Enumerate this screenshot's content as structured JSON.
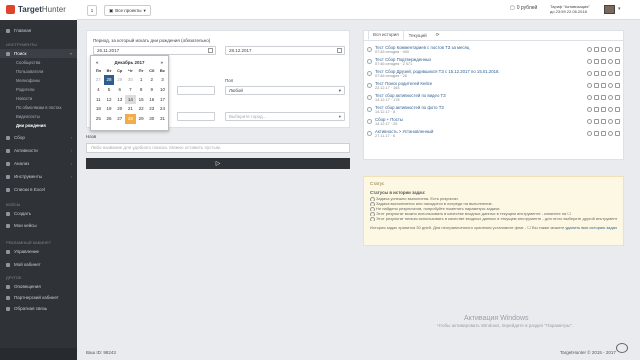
{
  "topbar": {
    "logo_target": "Target",
    "logo_hunter": "Hunter",
    "counter": "1",
    "projects_label": "Все проекты",
    "money": "0 рублей",
    "tariff_line1": "Тариф \"Активизация\"",
    "tariff_line2": "до 23:59 22.06.2018"
  },
  "sidebar": {
    "home": "Главная",
    "tools_section": "ИНСТРУМЕНТЫ",
    "search": "Поиск",
    "search_sub": [
      "Сообщества",
      "Пользователи",
      "Мелиофаны",
      "Родители",
      "Новости",
      "По обмолвкам в постах",
      "Видеопосты",
      "Дни рождения"
    ],
    "others": [
      "Сбор",
      "Активности",
      "Анализ",
      "Инструменты",
      "Списки в Excel"
    ],
    "cases_section": "КЕЙСЫ",
    "cases": [
      "Создать",
      "Мои кейсы"
    ],
    "cabinet_section": "РЕКЛАМНЫЙ КАБИНЕТ",
    "cabinet": [
      "Управление",
      "Мой кабинет"
    ],
    "other_section": "ДРУГОЕ",
    "other": [
      "Оповещения",
      "Партнерский кабинет",
      "Обратная связь"
    ]
  },
  "form": {
    "period_label": "Период, за который искать дни рождения (обязательно)",
    "date_from": "26.11.2017",
    "date_to": "28.12.2017",
    "gender_label": "Пол",
    "gender_value": "Любой",
    "city_placeholder": "Выберите город...",
    "desc_label": "Назв",
    "desc_placeholder": "Либо название для удобного поиска. Можно оставить пустым.",
    "run_label": "▷"
  },
  "calendar": {
    "prev": "«",
    "next": "»",
    "month": "Декабрь 2017",
    "dow": [
      "Пн",
      "Вт",
      "Ср",
      "Чт",
      "Пт",
      "Сб",
      "Вс"
    ],
    "days": [
      "27",
      "28",
      "29",
      "30",
      "1",
      "2",
      "3",
      "4",
      "5",
      "6",
      "7",
      "8",
      "9",
      "10",
      "11",
      "12",
      "13",
      "14",
      "15",
      "16",
      "17",
      "18",
      "19",
      "20",
      "21",
      "22",
      "23",
      "24",
      "25",
      "26",
      "27",
      "28",
      "29",
      "30",
      "31"
    ]
  },
  "history": {
    "tabs": [
      "Вся история",
      "Текущий"
    ],
    "rows": [
      {
        "title": "Тест Сбор Комментариев с постов ТЗ за месяц",
        "meta": "07:45 сегодня · 400"
      },
      {
        "title": "Тест Сбор Подтвержденных",
        "meta": "07:46 сегодня · 2 571"
      },
      {
        "title": "Тест Сбор Друзей, родившихся ТЗ с 15.12.2017 по 15.01.2018.",
        "meta": "07:46 сегодня · 26"
      },
      {
        "title": "Тест Поиск родителей Кейсе",
        "meta": "22.12.17 · 163"
      },
      {
        "title": "Тест сбор активностей по видео ТЗ",
        "meta": "14.12.17 · 178"
      },
      {
        "title": "Тест сбор активностей по фото ТЗ",
        "meta": "14.12.17 · 8"
      },
      {
        "title": "Сбор + Посты",
        "meta": "14.12.17 · 25"
      },
      {
        "title": "Активность > Установленный",
        "meta": "27.11.17 · 6"
      }
    ]
  },
  "status": {
    "header": "Статус",
    "title": "Статусы в истории задач:",
    "items": [
      "Задача успешно выполнена. Есть результат.",
      "Задача выполняется или находится в очереди на выполнение.",
      "Не найдено результатов, попробуйте поменять параметры задачи.",
      "Этот результат можно использовать в качестве входных данных в текущем инструменте - кликните на ☐",
      "Этот результат нельзя использовать в качестве входных данных в текущем инструменте - для этого выберите другой инструмент."
    ],
    "note": "История задач хранится 30 дней. Для неограниченного хранения установите флаг - ☐ Вы также можете",
    "note_link": "удалить всю историю задач"
  },
  "footer": {
    "left": "Ваш ID: 98243",
    "right": "TargetHunter © 2015 - 2017",
    "win_title": "Активация Windows",
    "win_sub": "Чтобы активировать Windows, перейдите в раздел \"Параметры\"."
  }
}
